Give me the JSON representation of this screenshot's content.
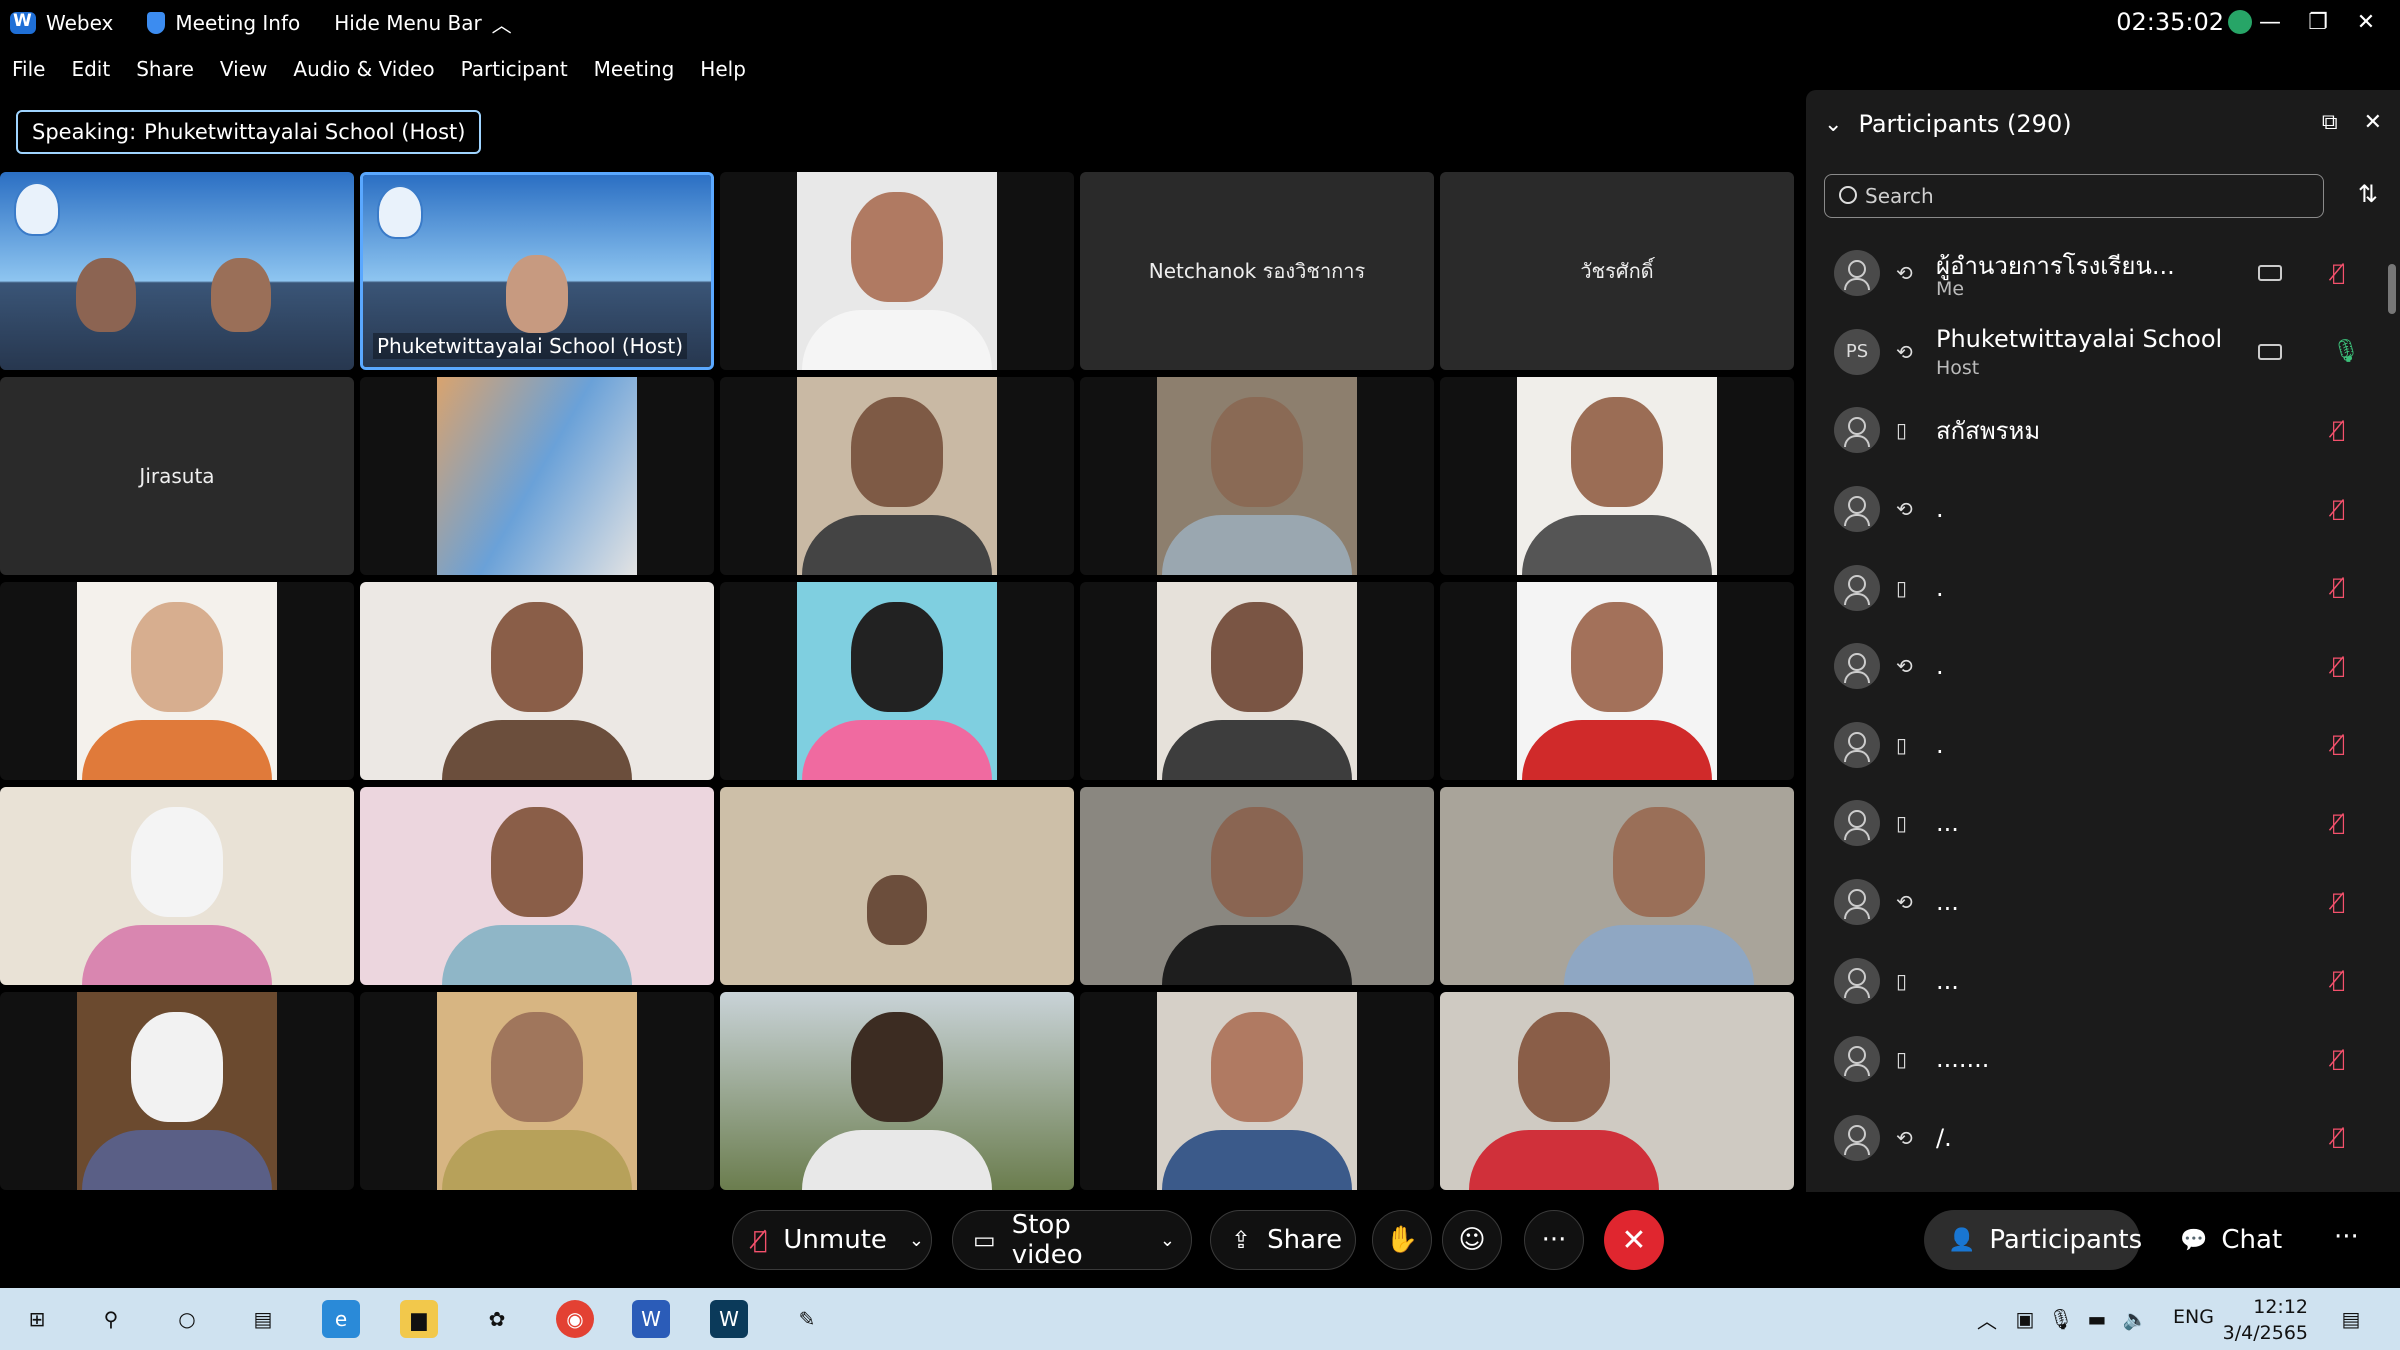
{
  "titlebar": {
    "app": "Webex",
    "meeting_info": "Meeting Info",
    "hide_menu": "Hide Menu Bar",
    "clock": "02:35:02"
  },
  "menu": [
    "File",
    "Edit",
    "Share",
    "View",
    "Audio & Video",
    "Participant",
    "Meeting",
    "Help"
  ],
  "speaking": {
    "prefix": "Speaking:",
    "name": "Phuketwittayalai School (Host)"
  },
  "tiles": [
    {
      "type": "banner",
      "label": ""
    },
    {
      "type": "banner",
      "label": "Phuketwittayalai School (Host)"
    },
    {
      "type": "video",
      "label": ""
    },
    {
      "type": "name",
      "label": "Netchanok รองวิชาการ"
    },
    {
      "type": "name",
      "label": "วัชรศักดิ์"
    },
    {
      "type": "name",
      "label": "Jirasuta"
    },
    {
      "type": "video",
      "label": ""
    },
    {
      "type": "video",
      "label": ""
    },
    {
      "type": "video",
      "label": ""
    },
    {
      "type": "video",
      "label": ""
    },
    {
      "type": "video",
      "label": ""
    },
    {
      "type": "video",
      "label": ""
    },
    {
      "type": "video",
      "label": ""
    },
    {
      "type": "video",
      "label": ""
    },
    {
      "type": "video",
      "label": ""
    },
    {
      "type": "video",
      "label": ""
    },
    {
      "type": "video",
      "label": ""
    },
    {
      "type": "video",
      "label": ""
    },
    {
      "type": "video",
      "label": ""
    },
    {
      "type": "video",
      "label": ""
    },
    {
      "type": "video",
      "label": ""
    },
    {
      "type": "video",
      "label": ""
    },
    {
      "type": "video",
      "label": ""
    },
    {
      "type": "video",
      "label": ""
    },
    {
      "type": "video",
      "label": ""
    }
  ],
  "participants_panel": {
    "title": "Participants (290)",
    "search_placeholder": "Search",
    "rows": [
      {
        "avatar": "",
        "device": "sync",
        "name": "ผู้อำนวยการโรงเรียน...",
        "sub": "Me",
        "video": true,
        "mic": "muted"
      },
      {
        "avatar": "PS",
        "device": "sync",
        "name": "Phuketwittayalai School",
        "sub": "Host",
        "video": true,
        "mic": "on"
      },
      {
        "avatar": "",
        "device": "phone",
        "name": "สกัสพรหม",
        "sub": "",
        "video": false,
        "mic": "muted"
      },
      {
        "avatar": "",
        "device": "sync",
        "name": ".",
        "sub": "",
        "video": false,
        "mic": "muted"
      },
      {
        "avatar": "",
        "device": "phone",
        "name": ".",
        "sub": "",
        "video": false,
        "mic": "muted"
      },
      {
        "avatar": "",
        "device": "sync",
        "name": ".",
        "sub": "",
        "video": false,
        "mic": "muted"
      },
      {
        "avatar": "",
        "device": "phone",
        "name": ".",
        "sub": "",
        "video": false,
        "mic": "muted"
      },
      {
        "avatar": "",
        "device": "phone",
        "name": "...",
        "sub": "",
        "video": false,
        "mic": "muted"
      },
      {
        "avatar": "",
        "device": "sync",
        "name": "...",
        "sub": "",
        "video": false,
        "mic": "muted"
      },
      {
        "avatar": "",
        "device": "phone",
        "name": "...",
        "sub": "",
        "video": false,
        "mic": "muted"
      },
      {
        "avatar": "",
        "device": "phone",
        "name": ".......",
        "sub": "",
        "video": false,
        "mic": "muted"
      },
      {
        "avatar": "",
        "device": "sync",
        "name": "/.",
        "sub": "",
        "video": false,
        "mic": "muted"
      }
    ]
  },
  "controls": {
    "unmute": "Unmute",
    "stop_video": "Stop video",
    "share": "Share",
    "participants": "Participants",
    "chat": "Chat"
  },
  "taskbar": {
    "lang": "ENG",
    "time": "12:12",
    "date": "3/4/2565"
  },
  "colors": {
    "accent": "#5aa8ff",
    "end_call": "#e0262f",
    "mute_icon": "#f4516c",
    "mic_on": "#3cc17a"
  }
}
